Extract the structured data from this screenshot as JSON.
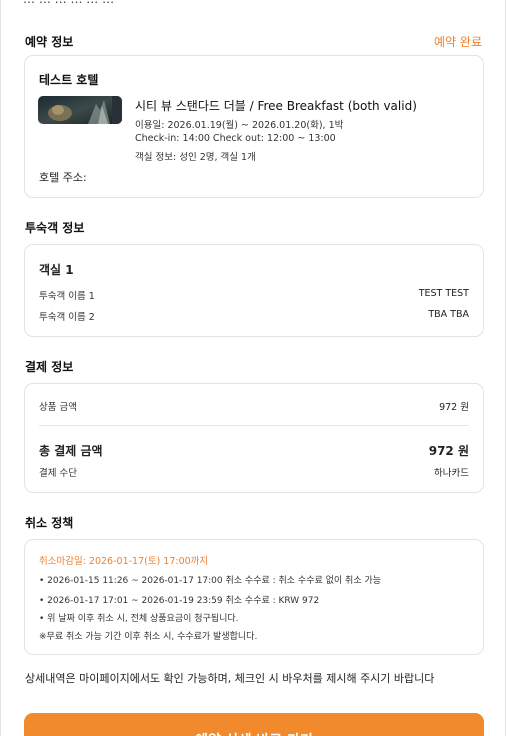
{
  "header": {
    "top_partial_text": "… … … … … …"
  },
  "reservation": {
    "section_title": "예약 정보",
    "status": "예약 완료",
    "hotel_name": "테스트 호텔",
    "room_title": "시티 뷰 스탠다드 더블 / Free Breakfast (both valid)",
    "stay_dates": "이용일: 2026.01.19(월) ~ 2026.01.20(화), 1박",
    "check_times": "Check-in: 14:00    Check out: 12:00 ~ 13:00",
    "room_info": "객실 정보: 성인 2명, 객실 1개",
    "address_label": "호텔 주소:"
  },
  "guests": {
    "section_title": "투숙객 정보",
    "room_label": "객실 1",
    "rows": [
      {
        "label": "투숙객 이름 1",
        "value": "TEST TEST"
      },
      {
        "label": "투숙객 이름 2",
        "value": "TBA TBA"
      }
    ]
  },
  "payment": {
    "section_title": "결제 정보",
    "product_label": "상품 금액",
    "product_value": "972 원",
    "total_label": "총 결제 금액",
    "total_value": "972 원",
    "method_label": "결제 수단",
    "method_value": "하나카드"
  },
  "cancellation": {
    "section_title": "취소 정책",
    "deadline": "취소마감일: 2026-01-17(토)  17:00까지",
    "policies": [
      "• 2026-01-15 11:26 ~ 2026-01-17 17:00 취소 수수료 : 취소 수수료 없이 취소 가능",
      "• 2026-01-17 17:01 ~ 2026-01-19 23:59 취소 수수료 : KRW 972",
      "• 위 날짜 이후 취소 시, 전체 상품요금이 청구됩니다.",
      "※무료 취소 가능 기간 이후 취소 시, 수수료가 발생합니다."
    ]
  },
  "footer": {
    "info_text": "상세내역은 마이페이지에서도 확인 가능하며, 체크인 시 바우처를 제시해 주시기 바랍니다",
    "cta_label": "예약 상세 바로 가기"
  },
  "colors": {
    "accent": "#f08a2c",
    "status": "#f08030",
    "border": "#e3e3e3"
  }
}
